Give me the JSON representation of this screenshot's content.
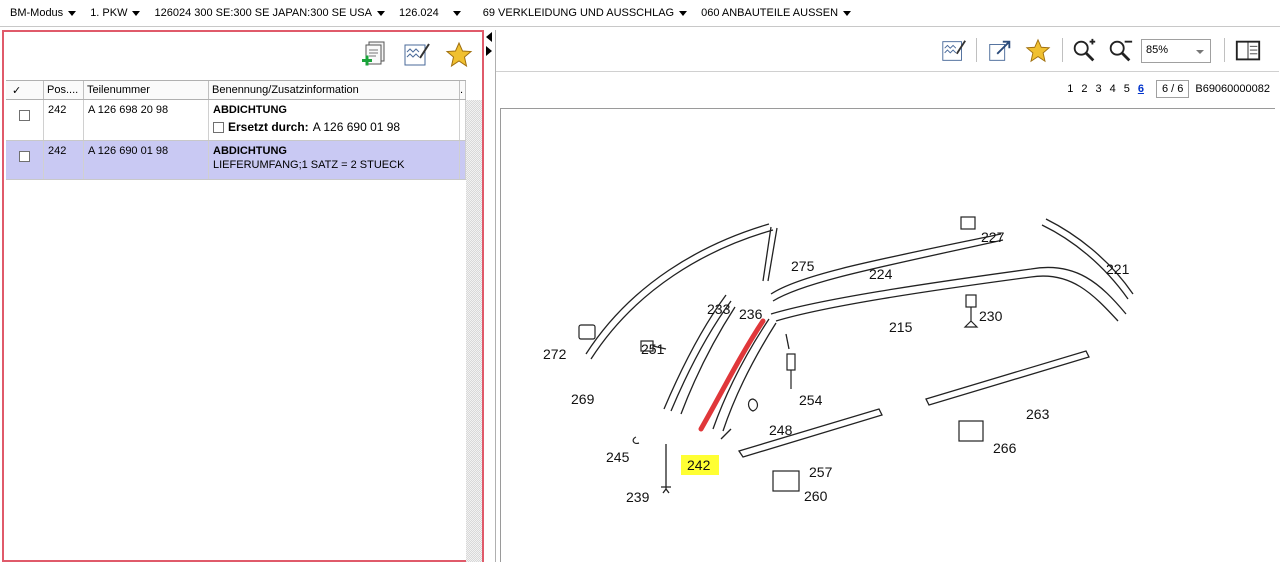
{
  "topbar": {
    "items": [
      {
        "label": "BM-Modus"
      },
      {
        "label": "1. PKW"
      },
      {
        "label": "126024 300 SE:300 SE JAPAN:300 SE USA"
      },
      {
        "label": "126.024"
      },
      {
        "label": "69 VERKLEIDUNG UND AUSSCHLAG"
      },
      {
        "label": "060 ANBAUTEILE AUSSEN"
      }
    ]
  },
  "left_toolbar": {
    "icons": [
      "add-document-icon",
      "edit-list-icon",
      "favorite-star-icon"
    ]
  },
  "grid": {
    "headers": {
      "check": "✓",
      "pos": "Pos....",
      "teil": "Teilenummer",
      "ben": "Benennung/Zusatzinformation",
      "ext": "."
    },
    "rows": [
      {
        "pos": "242",
        "teil": "A 126 698 20 98",
        "title": "ABDICHTUNG",
        "sub_label": "Ersetzt durch:",
        "sub_value": "A 126 690 01 98",
        "selected": false
      },
      {
        "pos": "242",
        "teil": "A 126 690 01 98",
        "title": "ABDICHTUNG",
        "info": "LIEFERUMFANG;1 SATZ = 2 STUECK",
        "selected": true
      }
    ]
  },
  "right_toolbar": {
    "icons": [
      "edit-list-icon",
      "export-icon",
      "favorite-star-icon",
      "zoom-in-icon",
      "zoom-out-icon",
      "document-icon"
    ],
    "zoom": "85%"
  },
  "pager": {
    "pages": [
      "1",
      "2",
      "3",
      "4",
      "5",
      "6"
    ],
    "current": "6",
    "page_of": "6 / 6",
    "doc_id": "B69060000082"
  },
  "diagram": {
    "labels": [
      "227",
      "221",
      "275",
      "224",
      "233",
      "236",
      "215",
      "230",
      "272",
      "251",
      "269",
      "254",
      "263",
      "248",
      "245",
      "242",
      "266",
      "257",
      "239",
      "260"
    ],
    "highlight": "242",
    "colors": {
      "highlight_bg": "#ffff33",
      "highlight_part": "#e0373a"
    }
  }
}
